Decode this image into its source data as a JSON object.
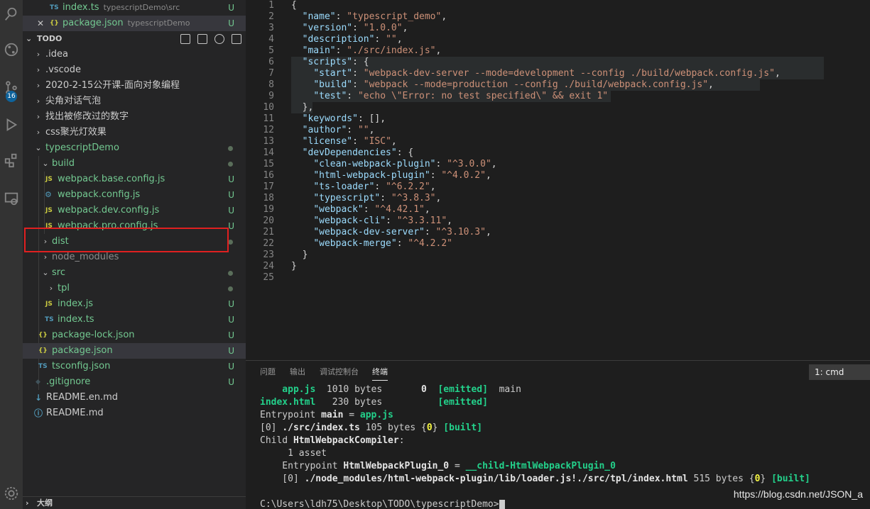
{
  "sidebar": {
    "open_editors": [
      {
        "icon": "TS",
        "name": "index.ts",
        "desc": "typescriptDemo\\src",
        "status": "U"
      },
      {
        "icon": "{}",
        "name": "package.json",
        "desc": "typescriptDemo",
        "status": "U",
        "close": "✕"
      }
    ],
    "section_title": "TODO",
    "outline_title": "大纲",
    "tree": [
      {
        "label": ".idea"
      },
      {
        "label": ".vscode"
      },
      {
        "label": "2020-2-15公开课-面向对象编程"
      },
      {
        "label": "尖角对话气泡"
      },
      {
        "label": "找出被修改过的数字"
      },
      {
        "label": "css聚光灯效果"
      },
      {
        "label": "typescriptDemo"
      },
      {
        "label": "build"
      },
      {
        "label": "webpack.base.config.js",
        "icon": "JS",
        "status": "U"
      },
      {
        "label": "webpack.config.js",
        "icon": "⚙",
        "status": "U"
      },
      {
        "label": "webpack.dev.config.js",
        "icon": "JS",
        "status": "U"
      },
      {
        "label": "webpack.pro.config.js",
        "icon": "JS",
        "status": "U"
      },
      {
        "label": "dist"
      },
      {
        "label": "node_modules"
      },
      {
        "label": "src"
      },
      {
        "label": "tpl"
      },
      {
        "label": "index.js",
        "icon": "JS",
        "status": "U"
      },
      {
        "label": "index.ts",
        "icon": "TS",
        "status": "U"
      },
      {
        "label": "package-lock.json",
        "icon": "{}",
        "status": "U"
      },
      {
        "label": "package.json",
        "icon": "{}",
        "status": "U"
      },
      {
        "label": "tsconfig.json",
        "icon": "TS",
        "status": "U"
      },
      {
        "label": ".gitignore",
        "icon": "◆",
        "status": "U"
      },
      {
        "label": "README.en.md",
        "icon": "↓"
      },
      {
        "label": "README.md",
        "icon": "ⓘ"
      }
    ]
  },
  "activity": {
    "badge": "16"
  },
  "editor": {
    "line_numbers": [
      "1",
      "2",
      "3",
      "4",
      "5",
      "6",
      "7",
      "8",
      "9",
      "10",
      "11",
      "12",
      "13",
      "14",
      "15",
      "16",
      "17",
      "18",
      "19",
      "20",
      "21",
      "22",
      "23",
      "24",
      "25"
    ],
    "lines": [
      "{",
      "  \"name\": \"typescript_demo\",",
      "  \"version\": \"1.0.0\",",
      "  \"description\": \"\",",
      "  \"main\": \"./src/index.js\",",
      "  \"scripts\": {",
      "    \"start\": \"webpack-dev-server --mode=development --config ./build/webpack.config.js\",",
      "    \"build\": \"webpack --mode=production --config ./build/webpack.config.js\",",
      "    \"test\": \"echo \\\"Error: no test specified\\\" && exit 1\"",
      "  },",
      "  \"keywords\": [],",
      "  \"author\": \"\",",
      "  \"license\": \"ISC\",",
      "  \"devDependencies\": {",
      "    \"clean-webpack-plugin\": \"^3.0.0\",",
      "    \"html-webpack-plugin\": \"^4.0.2\",",
      "    \"ts-loader\": \"^6.2.2\",",
      "    \"typescript\": \"^3.8.3\",",
      "    \"webpack\": \"^4.42.1\",",
      "    \"webpack-cli\": \"^3.3.11\",",
      "    \"webpack-dev-server\": \"^3.10.3\",",
      "    \"webpack-merge\": \"^4.2.2\"",
      "  }",
      "}",
      ""
    ]
  },
  "panel": {
    "tabs": [
      "问题",
      "输出",
      "调试控制台",
      "终端"
    ],
    "terminal_select": "1: cmd",
    "watermark": "https://blog.csdn.net/JSON_a",
    "terminal": {
      "l1_a": "    app.js",
      "l1_b": "  1010 bytes       ",
      "l1_c": "0",
      "l1_d": "  ",
      "l1_e": "[emitted]",
      "l1_f": "  main",
      "l2_a": "index.html",
      "l2_b": "   230 bytes          ",
      "l2_c": "[emitted]",
      "l3_a": "Entrypoint ",
      "l3_b": "main",
      "l3_c": " = ",
      "l3_d": "app.js",
      "l4_a": "[0] ",
      "l4_b": "./src/index.ts",
      "l4_c": " 105 bytes {",
      "l4_d": "0",
      "l4_e": "} ",
      "l4_f": "[built]",
      "l5_a": "Child ",
      "l5_b": "HtmlWebpackCompiler",
      "l5_c": ":",
      "l6": "     1 asset",
      "l7_a": "    Entrypoint ",
      "l7_b": "HtmlWebpackPlugin_0",
      "l7_c": " = ",
      "l7_d": "__child-HtmlWebpackPlugin_0",
      "l8_a": "    [0] ",
      "l8_b": "./node_modules/html-webpack-plugin/lib/loader.js!./src/tpl/index.html",
      "l8_c": " 515 bytes {",
      "l8_d": "0",
      "l8_e": "} ",
      "l8_f": "[built]",
      "prompt": "C:\\Users\\ldh75\\Desktop\\TODO\\typescriptDemo>"
    }
  }
}
